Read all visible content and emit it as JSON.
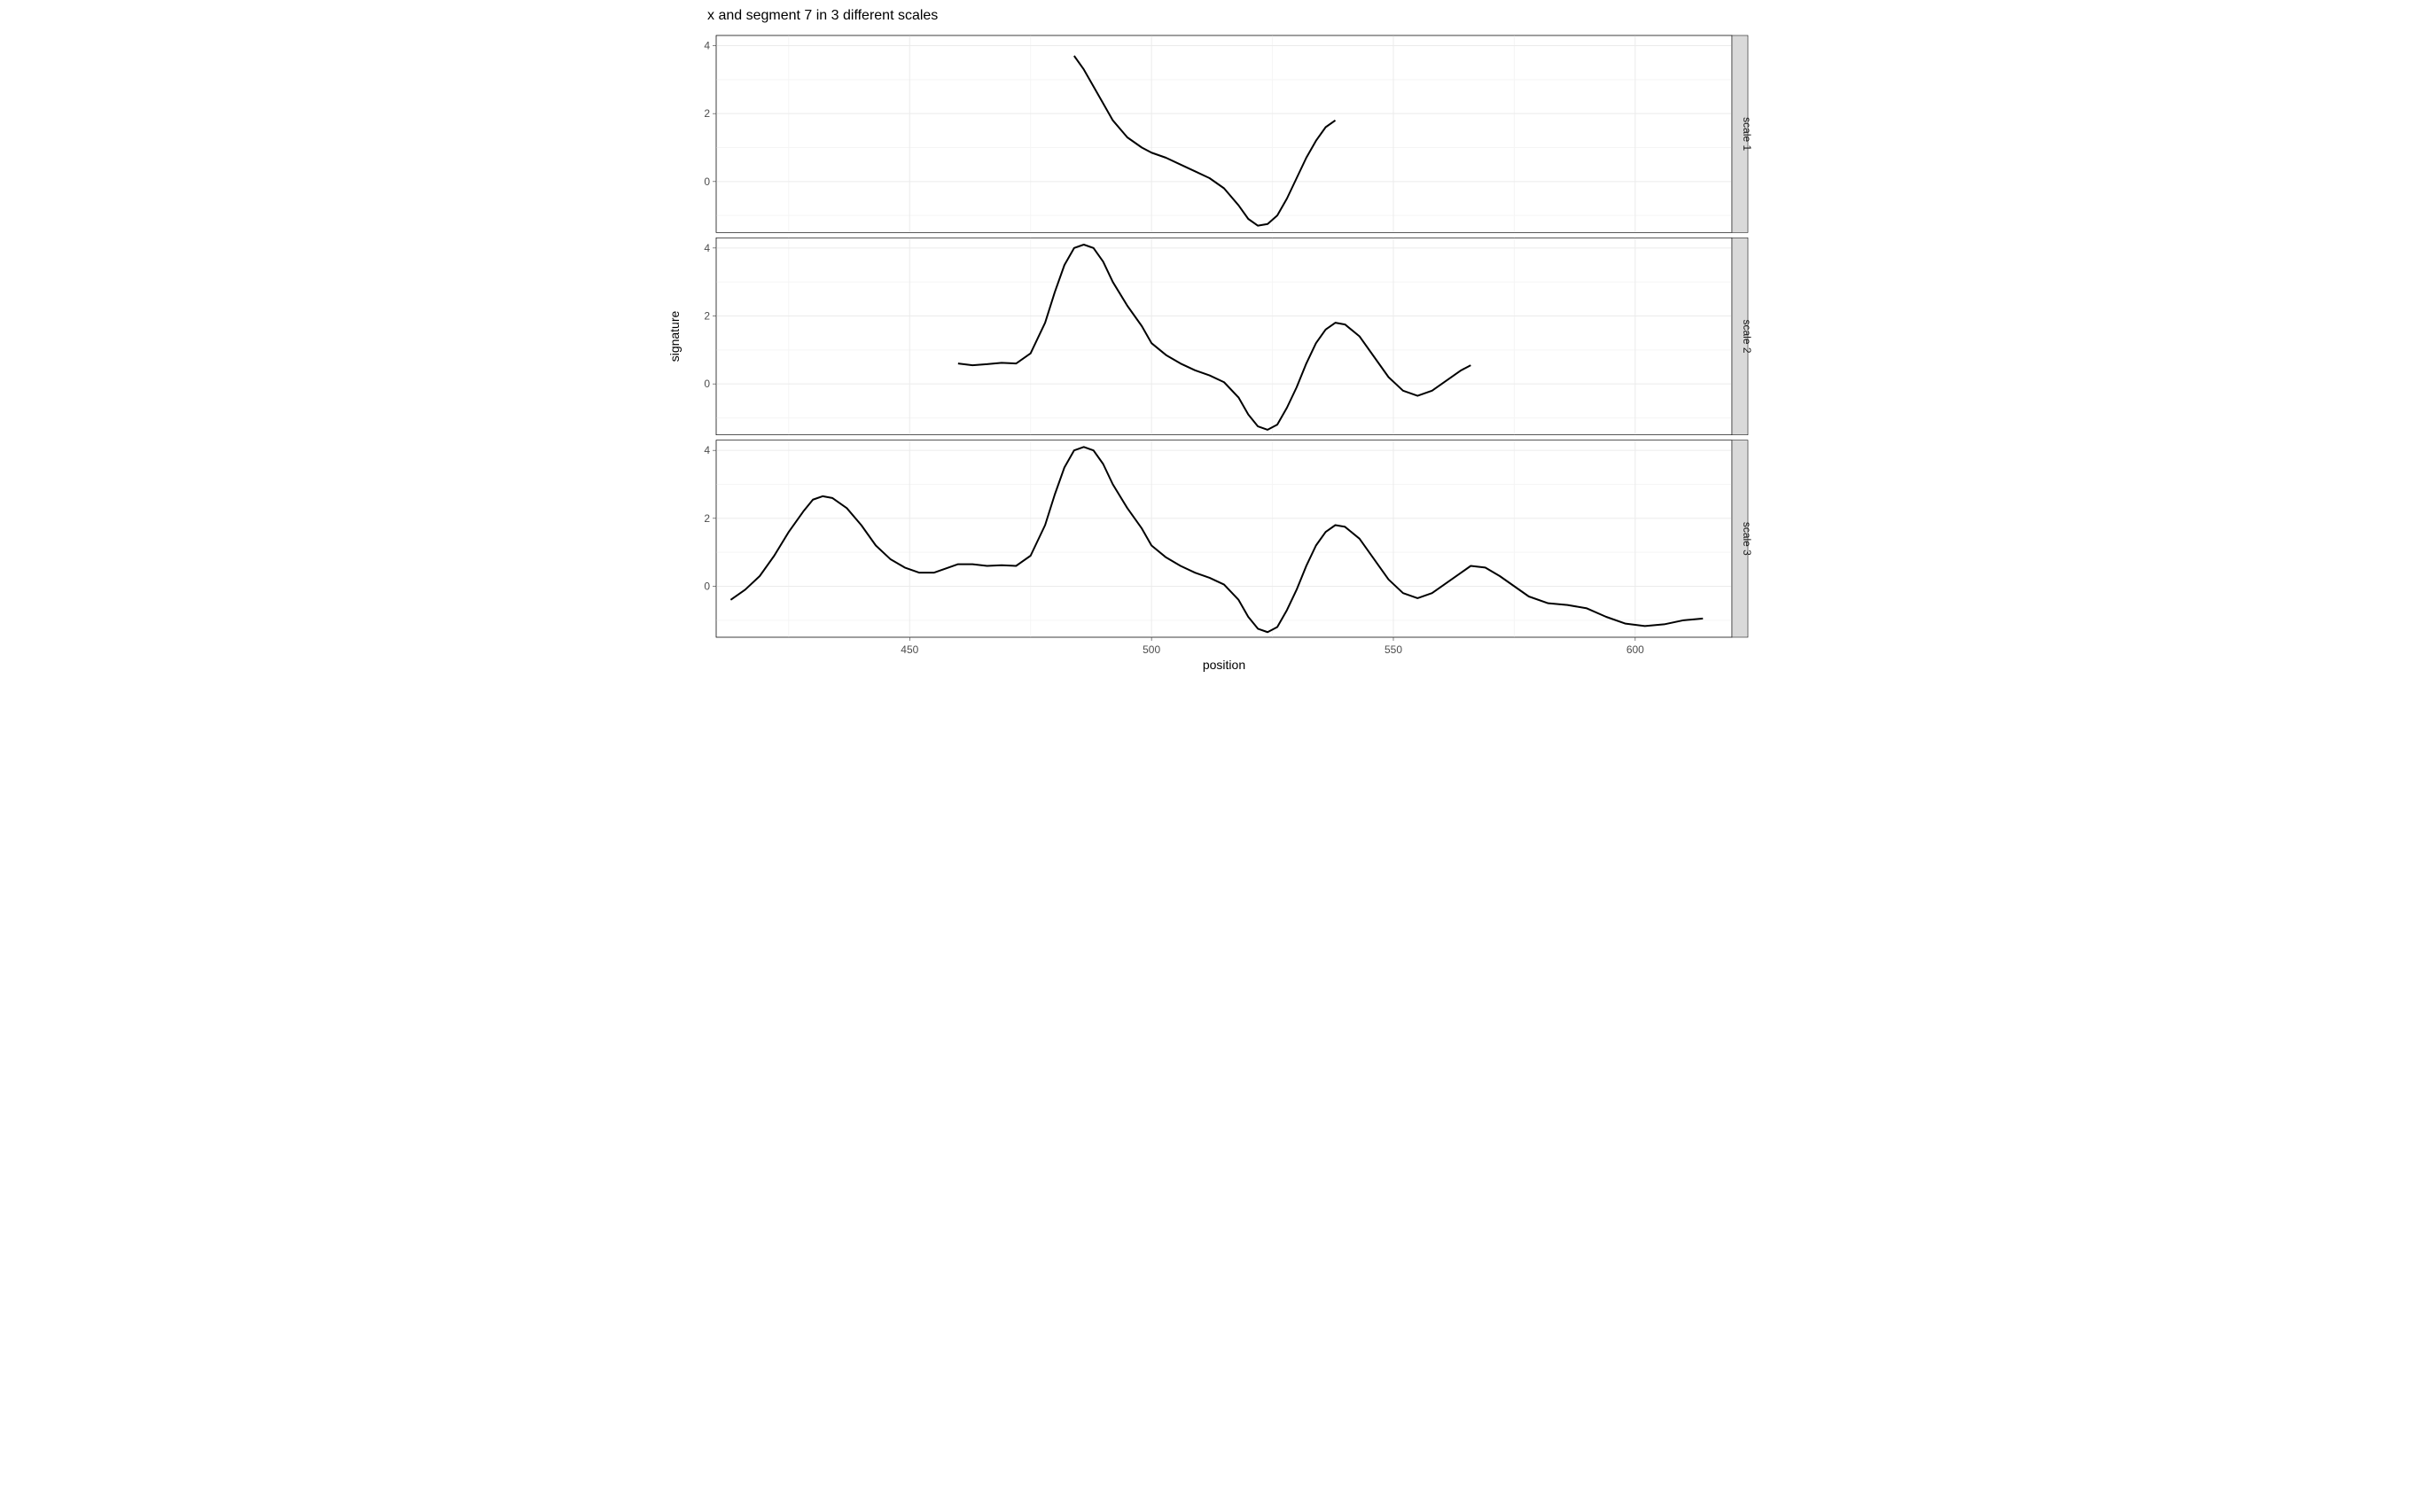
{
  "chart_data": {
    "type": "line",
    "title": "x and segment 7 in 3 different scales",
    "xlabel": "position",
    "ylabel": "signature",
    "xlim": [
      410,
      620
    ],
    "ylim": [
      -1.5,
      4.3
    ],
    "x_ticks": [
      450,
      500,
      550,
      600
    ],
    "y_ticks": [
      0,
      2,
      4
    ],
    "facets": [
      "scale 1",
      "scale 2",
      "scale 3"
    ],
    "series": [
      {
        "name": "scale 1",
        "x": [
          484,
          486,
          488,
          490,
          492,
          495,
          498,
          500,
          503,
          506,
          509,
          512,
          515,
          518,
          520,
          522,
          524,
          526,
          528,
          530,
          532,
          534,
          536,
          538
        ],
        "values": [
          3.7,
          3.3,
          2.8,
          2.3,
          1.8,
          1.3,
          1.0,
          0.85,
          0.7,
          0.5,
          0.3,
          0.1,
          -0.2,
          -0.7,
          -1.1,
          -1.3,
          -1.25,
          -1.0,
          -0.5,
          0.1,
          0.7,
          1.2,
          1.6,
          1.8
        ]
      },
      {
        "name": "scale 2",
        "x": [
          460,
          463,
          466,
          469,
          472,
          475,
          478,
          480,
          482,
          484,
          486,
          488,
          490,
          492,
          495,
          498,
          500,
          503,
          506,
          509,
          512,
          515,
          518,
          520,
          522,
          524,
          526,
          528,
          530,
          532,
          534,
          536,
          538,
          540,
          543,
          546,
          549,
          552,
          555,
          558,
          561,
          564,
          566
        ],
        "values": [
          0.6,
          0.55,
          0.58,
          0.62,
          0.6,
          0.9,
          1.8,
          2.7,
          3.5,
          4.0,
          4.1,
          4.0,
          3.6,
          3.0,
          2.3,
          1.7,
          1.2,
          0.85,
          0.6,
          0.4,
          0.25,
          0.05,
          -0.4,
          -0.9,
          -1.25,
          -1.35,
          -1.2,
          -0.7,
          -0.1,
          0.6,
          1.2,
          1.6,
          1.8,
          1.75,
          1.4,
          0.8,
          0.2,
          -0.2,
          -0.35,
          -0.2,
          0.1,
          0.4,
          0.55
        ]
      },
      {
        "name": "scale 3",
        "x": [
          413,
          416,
          419,
          422,
          425,
          428,
          430,
          432,
          434,
          437,
          440,
          443,
          446,
          449,
          452,
          455,
          458,
          460,
          463,
          466,
          469,
          472,
          475,
          478,
          480,
          482,
          484,
          486,
          488,
          490,
          492,
          495,
          498,
          500,
          503,
          506,
          509,
          512,
          515,
          518,
          520,
          522,
          524,
          526,
          528,
          530,
          532,
          534,
          536,
          538,
          540,
          543,
          546,
          549,
          552,
          555,
          558,
          561,
          564,
          566,
          569,
          572,
          575,
          578,
          582,
          586,
          590,
          594,
          598,
          602,
          606,
          610,
          614
        ],
        "values": [
          -0.4,
          -0.1,
          0.3,
          0.9,
          1.6,
          2.2,
          2.55,
          2.65,
          2.6,
          2.3,
          1.8,
          1.2,
          0.8,
          0.55,
          0.4,
          0.4,
          0.55,
          0.65,
          0.65,
          0.6,
          0.62,
          0.6,
          0.9,
          1.8,
          2.7,
          3.5,
          4.0,
          4.1,
          4.0,
          3.6,
          3.0,
          2.3,
          1.7,
          1.2,
          0.85,
          0.6,
          0.4,
          0.25,
          0.05,
          -0.4,
          -0.9,
          -1.25,
          -1.35,
          -1.2,
          -0.7,
          -0.1,
          0.6,
          1.2,
          1.6,
          1.8,
          1.75,
          1.4,
          0.8,
          0.2,
          -0.2,
          -0.35,
          -0.2,
          0.1,
          0.4,
          0.6,
          0.55,
          0.3,
          0.0,
          -0.3,
          -0.5,
          -0.55,
          -0.65,
          -0.9,
          -1.1,
          -1.17,
          -1.12,
          -1.0,
          -0.95
        ]
      }
    ]
  }
}
